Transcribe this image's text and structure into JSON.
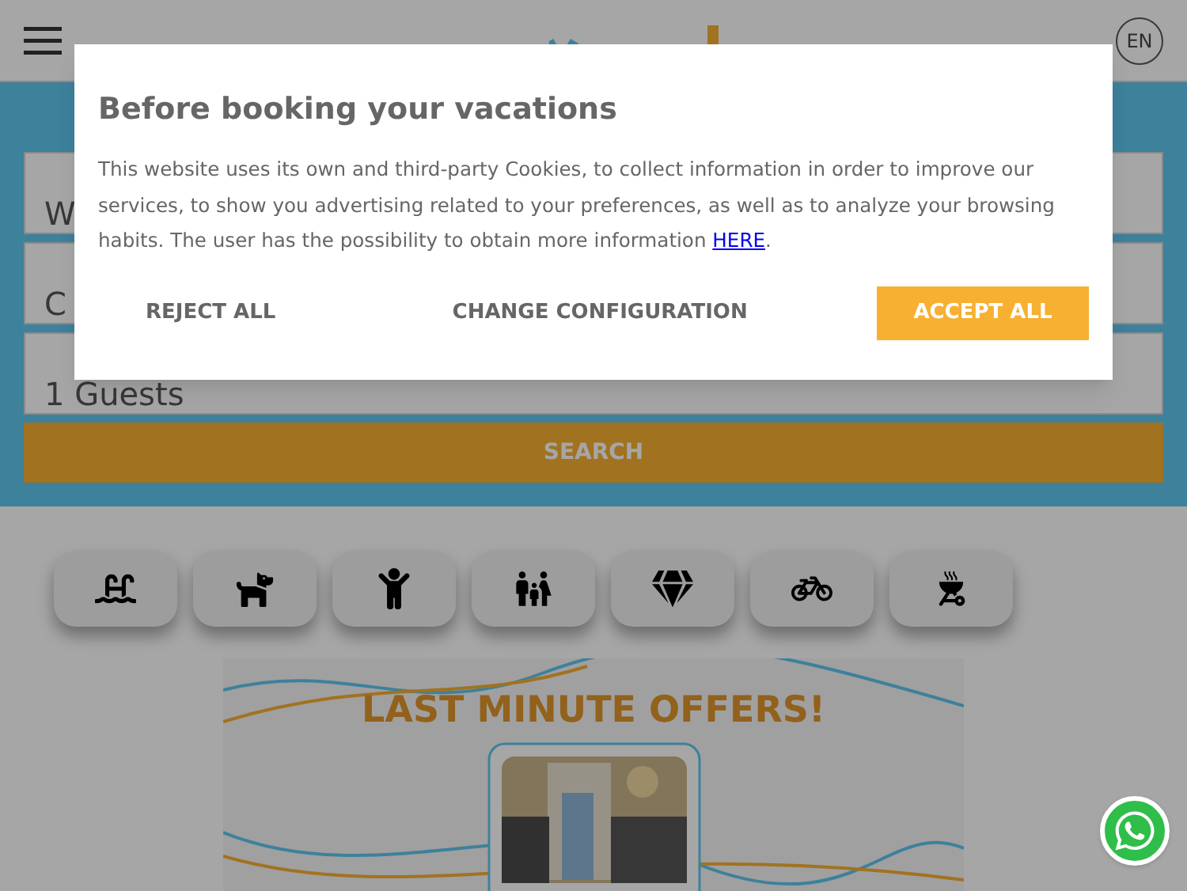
{
  "header": {
    "language": "EN"
  },
  "search": {
    "fields": [
      {
        "value": "W"
      },
      {
        "value": "C"
      },
      {
        "value": "1 Guests"
      }
    ],
    "button": "SEARCH"
  },
  "amenities": [
    {
      "kind": "pool"
    },
    {
      "kind": "pets"
    },
    {
      "kind": "kids"
    },
    {
      "kind": "family"
    },
    {
      "kind": "luxury"
    },
    {
      "kind": "bike"
    },
    {
      "kind": "barbecue"
    }
  ],
  "banner": {
    "title": "LAST MINUTE OFFERS!"
  },
  "cookie_dialog": {
    "title": "Before booking your vacations",
    "text": "This website uses its own and third-party Cookies, to collect information in order to improve our services, to show you advertising related to your preferences, as well as to analyze your browsing habits. The user has the possibility to obtain more information ",
    "link": "HERE",
    "text_end": ".",
    "buttons": [
      {
        "label": "REJECT ALL",
        "kind": "plain"
      },
      {
        "label": "CHANGE CONFIGURATION",
        "kind": "plain"
      },
      {
        "label": "ACCEPT ALL",
        "kind": "primary"
      }
    ]
  }
}
